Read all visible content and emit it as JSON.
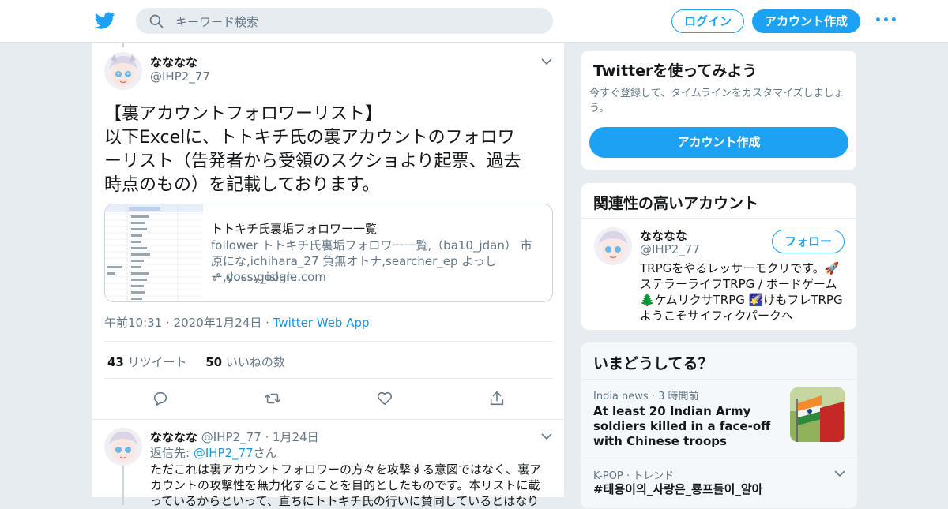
{
  "topbar": {
    "search_placeholder": "キーワード検索",
    "login_label": "ログイン",
    "signup_label": "アカウント作成",
    "more_label": "•••"
  },
  "tweet": {
    "author_name": "なななな",
    "author_handle": "@IHP2_77",
    "text_lines": [
      "【裏アカウントフォロワーリスト】",
      "以下Excelに、トトキチ氏の裏アカウントのフォロワ",
      "ーリスト（告発者から受領のスクショより起票、過去",
      "時点のもの）を記載しております。"
    ],
    "card": {
      "title": "トトキチ氏裏垢フォロワー一覧",
      "desc": "follower トトキチ氏裏垢フォロワー一覧,（ba10_jdan） 市原にな,ichihara_27 負無オトナ,searcher_ep よっしー,yossy_islan...",
      "link": "docs.google.com"
    },
    "time": "午前10:31",
    "date": "2020年1月24日",
    "app": "Twitter Web App",
    "retweets_count": "43",
    "retweets_label": "リツイート",
    "likes_count": "50",
    "likes_label": "いいねの数"
  },
  "reply": {
    "author_name": "なななな",
    "author_handle": "@IHP2_77",
    "date": "1月24日",
    "reply_to_label": "返信先:",
    "reply_to_handle": "@IHP2_77",
    "reply_to_suffix": "さん",
    "text": "ただこれは裏アカウントフォロワーの方々を攻撃する意図ではなく、裏アカウントの攻撃性を無力化することを目的としたものです。本リストに載っているからといって、直ちにトトキチ氏の行いに賛同しているとはなり"
  },
  "sidebar": {
    "promo": {
      "title": "Twitterを使ってみよう",
      "sub": "今すぐ登録して、タイムラインをカスタマイズしましょう。",
      "button": "アカウント作成"
    },
    "related": {
      "title": "関連性の高いアカウント",
      "name": "なななな",
      "handle": "@IHP2_77",
      "follow_label": "フォロー",
      "bio": "TRPGをやるレッサーモクリです。🚀ステラーライフTRPG / ボードゲーム 🌲ケムリクサTRPG 🌠けもフレTRPGようこそサイフィクパークへ"
    },
    "trends": {
      "title": "いまどうしてる？",
      "items": [
        {
          "source": "India news",
          "time": "3 時間前",
          "title": "At least 20 Indian Army soldiers killed in a face-off with Chinese troops"
        },
        {
          "source": "K-POP",
          "time": "トレンド",
          "title": "#태용이의_사랑은_룡프들이_알아"
        }
      ]
    }
  },
  "colors": {
    "accent": "#1da1f2",
    "link": "#1b95e0",
    "muted": "#657786",
    "bg": "#e6ecf0"
  }
}
